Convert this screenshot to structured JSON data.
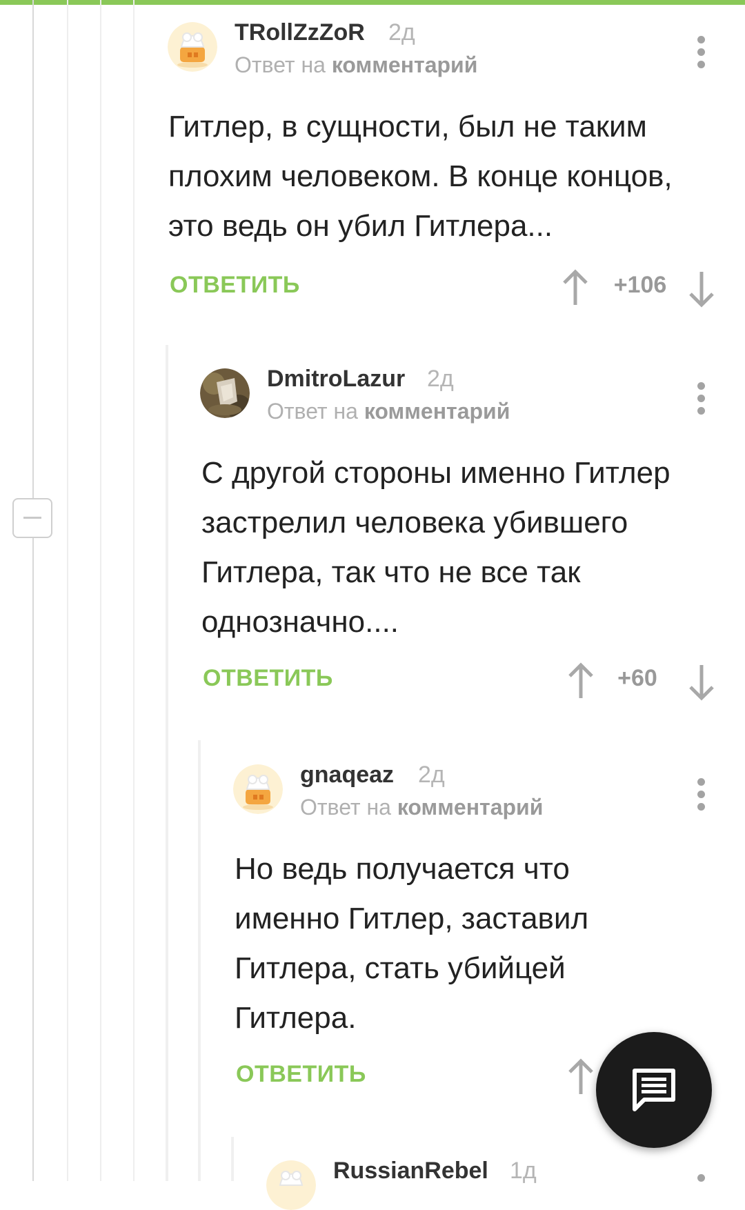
{
  "theme": {
    "accent": "#8ac858",
    "top_bar": "#8ac858"
  },
  "comments": [
    {
      "username": "TRollZzZoR",
      "time": "2д",
      "reply_prefix": "Ответ на",
      "reply_target": "комментарий",
      "text": "Гитлер, в сущности, был не таким плохим человеком. В конце концов, это ведь он убил Гитлера...",
      "reply_label": "ОТВЕТИТЬ",
      "rating": "+106",
      "avatar": "default-avatar-icon"
    },
    {
      "username": "DmitroLazur",
      "time": "2д",
      "reply_prefix": "Ответ на",
      "reply_target": "комментарий",
      "text": "С другой стороны именно Гитлер застрелил человека убившего Гитлера, так что не все так однозначно....",
      "reply_label": "ОТВЕТИТЬ",
      "rating": "+60",
      "avatar": "user-photo-avatar"
    },
    {
      "username": "gnaqeaz",
      "time": "2д",
      "reply_prefix": "Ответ на",
      "reply_target": "комментарий",
      "text": "Но ведь получается что именно Гитлер, заставил Гитлера, стать убийцей Гитлера.",
      "reply_label": "ОТВЕТИТЬ",
      "avatar": "default-avatar-icon"
    },
    {
      "username": "RussianRebel",
      "time": "1д",
      "avatar": "default-avatar-icon"
    }
  ],
  "fab": {
    "icon": "comment-icon"
  }
}
